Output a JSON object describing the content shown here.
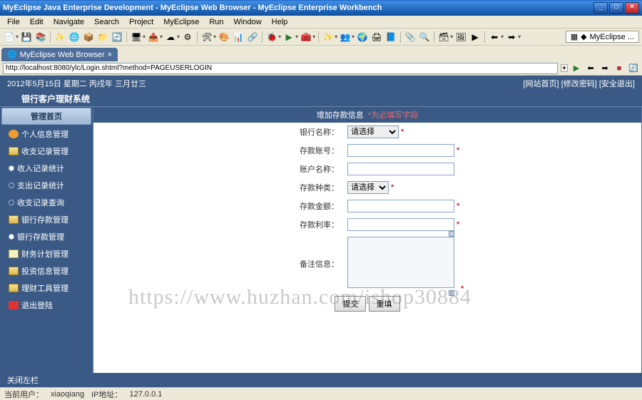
{
  "window": {
    "title": "MyEclipse Java Enterprise Development - MyEclipse Web Browser - MyEclipse Enterprise Workbench"
  },
  "menu": {
    "file": "File",
    "edit": "Edit",
    "navigate": "Navigate",
    "search": "Search",
    "project": "Project",
    "myeclipse": "MyEclipse",
    "run": "Run",
    "window": "Window",
    "help": "Help"
  },
  "perspective": {
    "label": "MyEclipse ..."
  },
  "tab": {
    "label": "MyEclipse Web Browser"
  },
  "address": {
    "url": "http://localhost:8080/ylc/Login.shtml?method=PAGEUSERLOGIN"
  },
  "page_header": {
    "date": "2012年5月15日 星期二 丙戌年 三月廿三",
    "link_home": "[网站首页]",
    "link_pwd": "[修改密码]",
    "link_exit": "[安全退出]"
  },
  "system_title": "银行客户理财系统",
  "nav": {
    "header": "管理首页",
    "items": [
      {
        "label": "个人信息管理"
      },
      {
        "label": "收支记录管理"
      },
      {
        "label": "收入记录统计"
      },
      {
        "label": "支出记录统计"
      },
      {
        "label": "收支记录查询"
      },
      {
        "label": "银行存款管理"
      },
      {
        "label": "银行存款管理"
      },
      {
        "label": "财务计划管理"
      },
      {
        "label": "投资信息管理"
      },
      {
        "label": "理财工具管理"
      },
      {
        "label": "退出登陆"
      }
    ]
  },
  "form": {
    "title": "增加存款信息",
    "req_hint": "*为必填写字段",
    "bank_label": "银行名称：",
    "bank_placeholder": "请选择",
    "acct_label": "存款账号：",
    "acct_name_label": "账户名称：",
    "type_label": "存款种类：",
    "type_placeholder": "请选择",
    "amount_label": "存款金额：",
    "rate_label": "存款利率：",
    "remark_label": "备注信息：",
    "submit": "提交",
    "reset": "重填"
  },
  "footer": {
    "close_hint": "关闭左栏"
  },
  "statusbar": {
    "user_label": "当前用户：",
    "user_value": "xiaoqiang",
    "ip_label": "IP地址：",
    "ip_value": "127.0.0.1"
  },
  "watermark": "https://www.huzhan.com/ishop30884"
}
